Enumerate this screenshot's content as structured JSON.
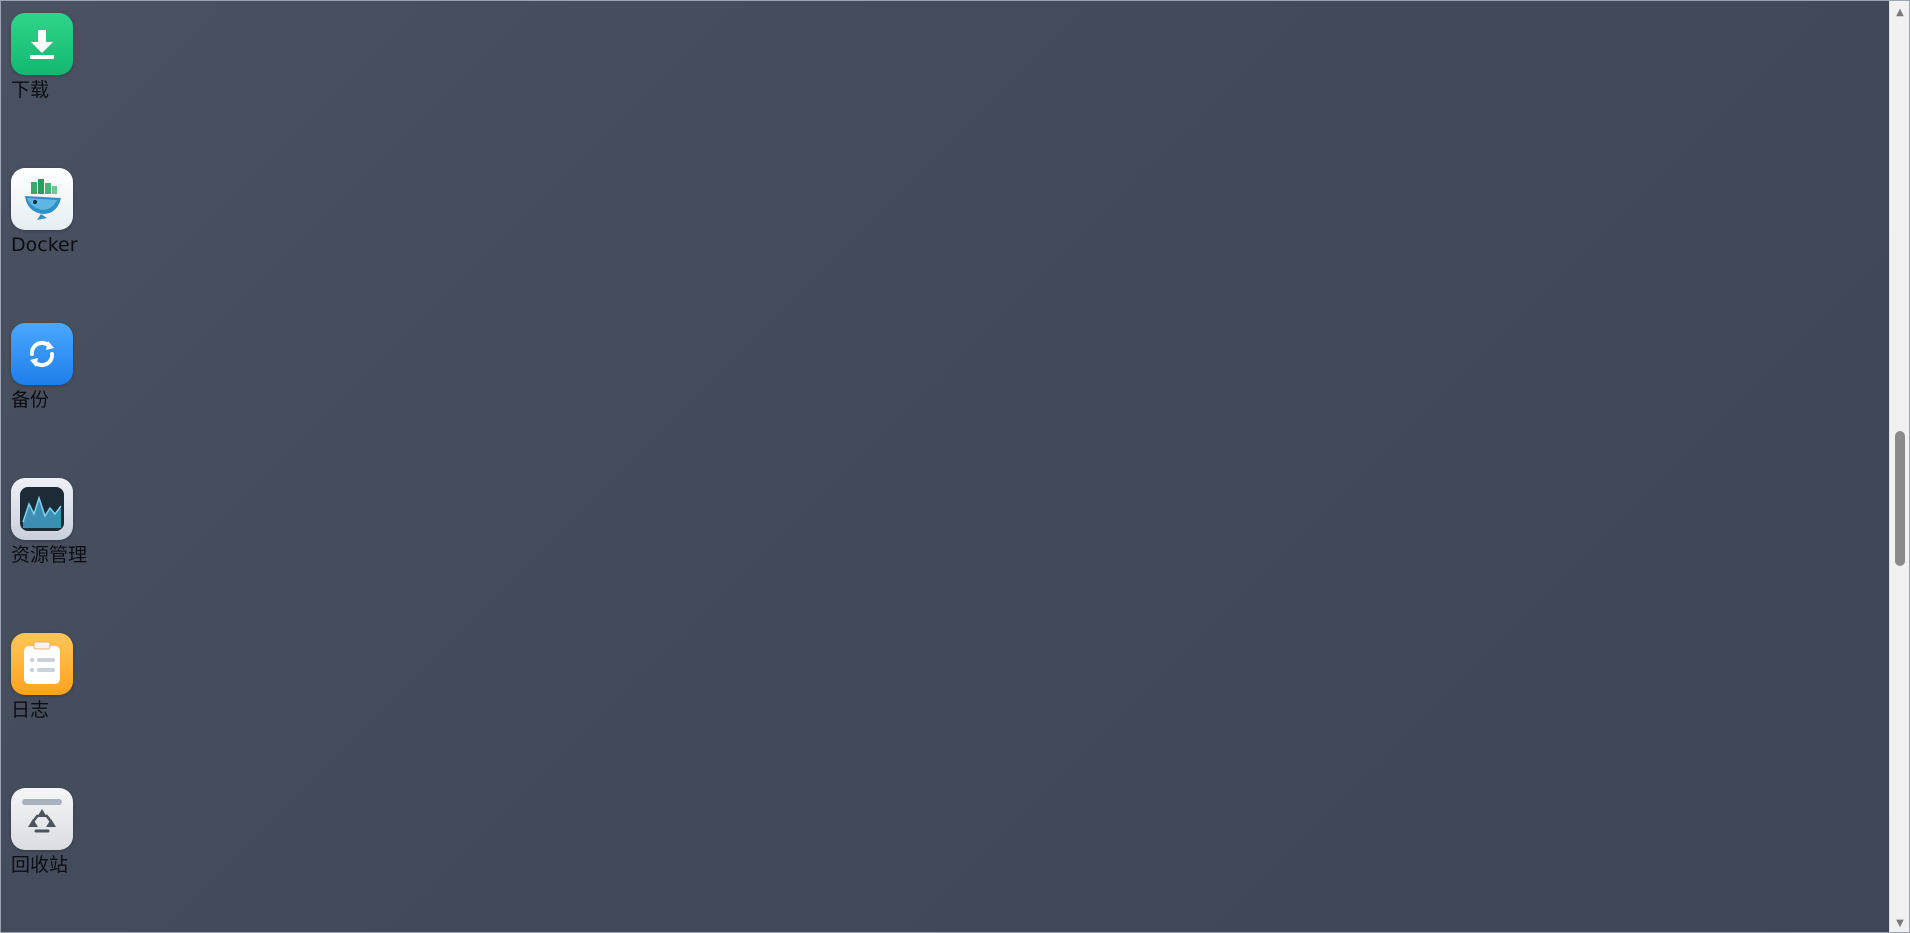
{
  "desktop": {
    "apps": [
      {
        "label": "下载",
        "icon": "download-icon",
        "color": "#1cc47c"
      },
      {
        "label": "Docker",
        "icon": "docker-icon",
        "color": "#e8f0f4"
      },
      {
        "label": "备份",
        "icon": "backup-sync-icon",
        "color": "#2f8ff2"
      },
      {
        "label": "资源管理",
        "icon": "resource-monitor-icon",
        "color": "#dfe3ec"
      },
      {
        "label": "日志",
        "icon": "log-clipboard-icon",
        "color": "#ffb33a"
      },
      {
        "label": "回收站",
        "icon": "recycle-bin-icon",
        "color": "#e6e9ed"
      }
    ]
  },
  "colors": {
    "background": "#454d5d",
    "label_text": "#0b0d12",
    "scroll_thumb": "#8a8a8a"
  }
}
